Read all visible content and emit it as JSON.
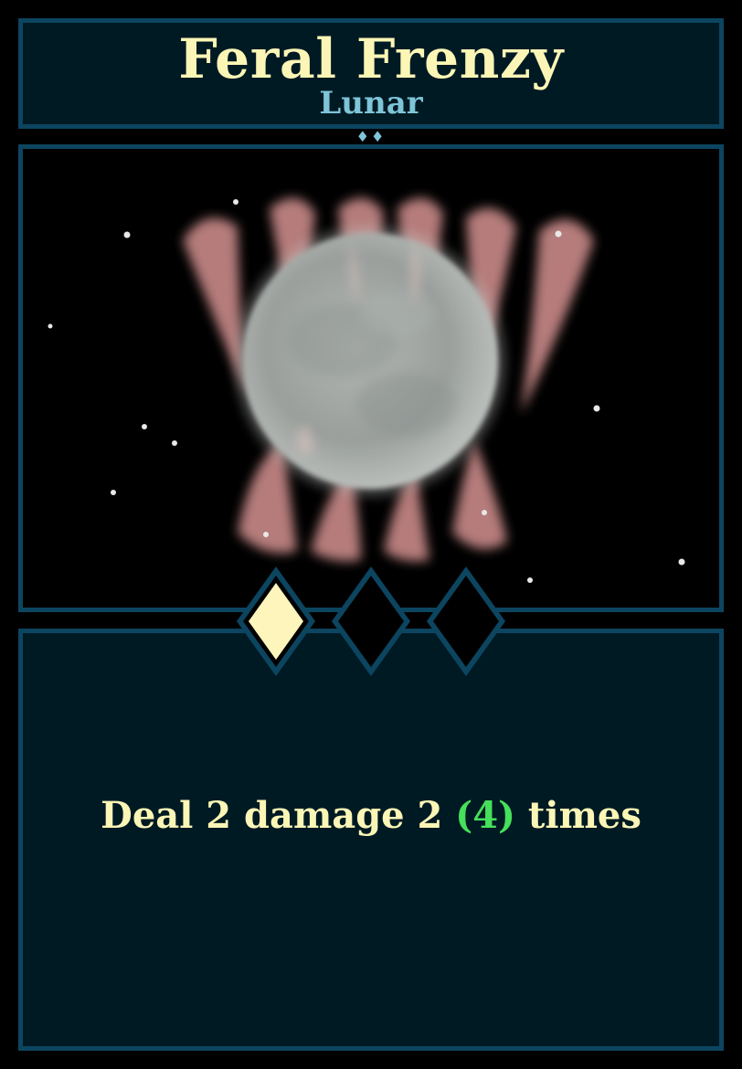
{
  "card": {
    "name": "Feral Frenzy",
    "type": "Lunar",
    "cost_pips": "♦♦",
    "description": {
      "before": "Deal 2 damage 2 ",
      "upgrade": "(4)",
      "after": " times"
    },
    "energy": {
      "filled": 1,
      "total": 3
    }
  },
  "colors": {
    "background": "#000000",
    "panel": "#001a24",
    "border": "#0c4560",
    "title_text": "#fbf6b6",
    "subtitle_text": "#7ec5d8",
    "upgrade_text": "#46e05a",
    "gem_filled": "#fdf5bb",
    "art_fangs": "#c98a89",
    "art_moon": "#a7aca9"
  },
  "art": {
    "subject": "full moon between fangs in starry night sky"
  }
}
